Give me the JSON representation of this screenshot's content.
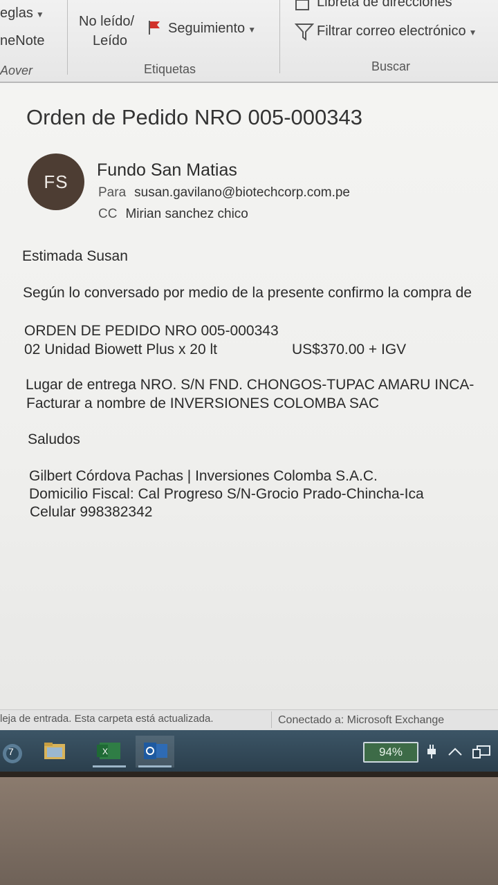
{
  "ribbon": {
    "reglas": "eglas",
    "onenote": "neNote",
    "mover_group": "Aover",
    "no_leido_line1": "No leído/",
    "no_leido_line2": "Leído",
    "seguimiento": "Seguimiento",
    "etiquetas_group": "Etiquetas",
    "libreta": "Libreta de direcciones",
    "filtrar": "Filtrar correo electrónico",
    "buscar_group": "Buscar"
  },
  "email": {
    "subject": "Orden de Pedido NRO 005-000343",
    "avatar_initials": "FS",
    "sender": "Fundo San Matias",
    "to_label": "Para",
    "to_value": "susan.gavilano@biotechcorp.com.pe",
    "cc_label": "CC",
    "cc_value": "Mirian sanchez chico",
    "greeting": "Estimada Susan",
    "intro": "Según lo conversado por medio de la presente confirmo la compra de",
    "order_line": "ORDEN DE PEDIDO NRO 005-000343",
    "item_line": "02 Unidad Biowett Plus x 20 lt",
    "item_price": "US$370.00 + IGV",
    "delivery_line": "Lugar de entrega NRO. S/N FND. CHONGOS-TUPAC AMARU INCA-",
    "invoice_line": "Facturar a nombre de INVERSIONES COLOMBA SAC",
    "closing": "Saludos",
    "sig_line1": "Gilbert Córdova Pachas | Inversiones Colomba S.A.C.",
    "sig_line2": "Domicilio Fiscal: Cal Progreso S/N-Grocio Prado-Chincha-Ica",
    "sig_line3": "Celular 998382342"
  },
  "statusbar": {
    "left": "leja de entrada.  Esta carpeta está actualizada.",
    "right": "Conectado a: Microsoft Exchange"
  },
  "taskbar": {
    "badge": "7",
    "battery": "94%"
  }
}
